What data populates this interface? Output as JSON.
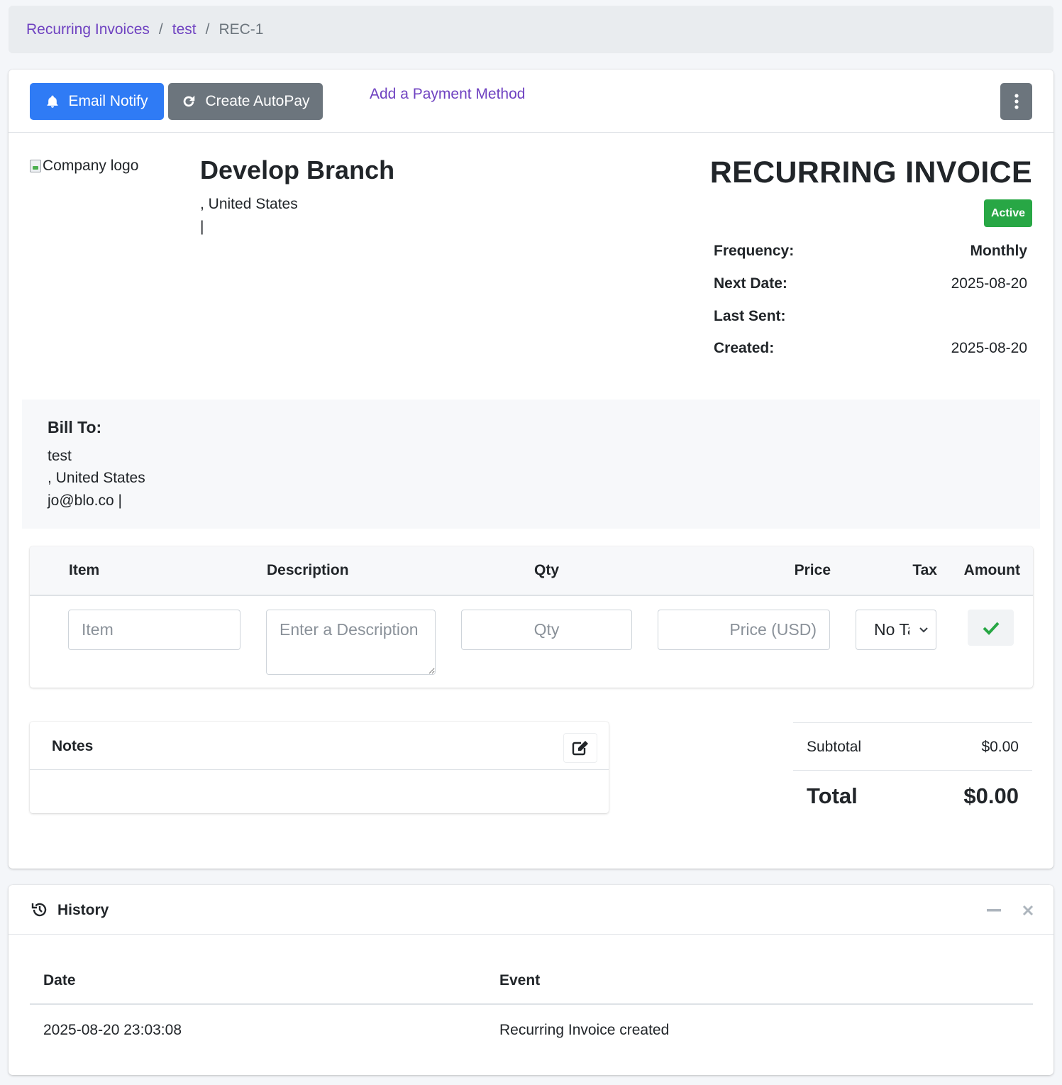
{
  "breadcrumb": {
    "items": [
      "Recurring Invoices",
      "test"
    ],
    "separator": "/",
    "current": "REC-1"
  },
  "toolbar": {
    "email_notify": "Email Notify",
    "create_autopay": "Create AutoPay",
    "add_payment_method": "Add a Payment Method"
  },
  "company": {
    "logo_alt": "Company logo",
    "name": "Develop Branch",
    "address": ", United States",
    "contact": "|"
  },
  "invoice": {
    "title": "RECURRING INVOICE",
    "status": "Active",
    "status_color": "#28a745",
    "meta": [
      {
        "label": "Frequency:",
        "value": "Monthly"
      },
      {
        "label": "Next Date:",
        "value": "2025-08-20"
      },
      {
        "label": "Last Sent:",
        "value": ""
      },
      {
        "label": "Created:",
        "value": "2025-08-20"
      }
    ]
  },
  "bill_to": {
    "heading": "Bill To:",
    "name": "test",
    "address": ", United States",
    "contact": "jo@blo.co |"
  },
  "items": {
    "headers": [
      "Item",
      "Description",
      "Qty",
      "Price",
      "Tax",
      "Amount"
    ],
    "placeholders": {
      "item": "Item",
      "description": "Enter a Description",
      "qty": "Qty",
      "price": "Price (USD)"
    },
    "tax_selected": "No Tax"
  },
  "notes": {
    "title": "Notes",
    "content": ""
  },
  "totals": {
    "subtotal_label": "Subtotal",
    "subtotal": "$0.00",
    "total_label": "Total",
    "total": "$0.00"
  },
  "history": {
    "title": "History",
    "headers": [
      "Date",
      "Event"
    ],
    "rows": [
      {
        "date": "2025-08-20 23:03:08",
        "event": "Recurring Invoice created"
      }
    ]
  },
  "colors": {
    "primary": "#2f7bf5",
    "secondary": "#6c757d",
    "link": "#6f42c1",
    "success": "#28a745"
  }
}
